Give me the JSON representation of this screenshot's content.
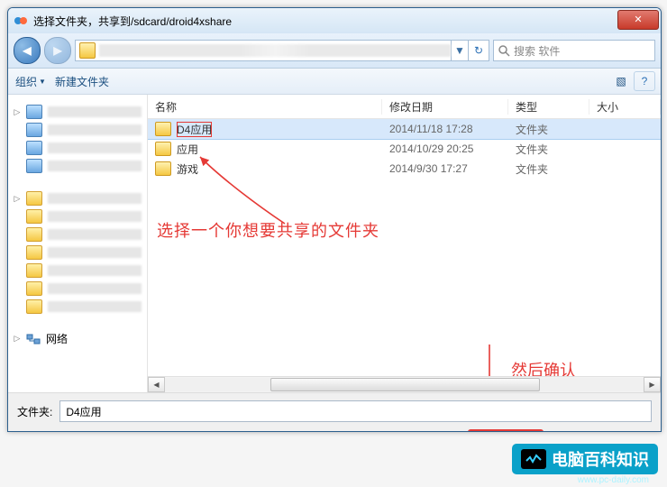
{
  "window": {
    "title": "选择文件夹，共享到/sdcard/droid4xshare",
    "close_x": "✕"
  },
  "nav": {
    "back_glyph": "◀",
    "fwd_glyph": "▶",
    "drop_glyph": "▼",
    "refresh_glyph": "↻"
  },
  "search": {
    "placeholder": "搜索 软件"
  },
  "toolbar": {
    "organize": "组织",
    "caret": "▼",
    "newfolder": "新建文件夹",
    "view_glyph": "▧",
    "help_glyph": "?"
  },
  "sidebar": {
    "network_label": "网络"
  },
  "columns": {
    "name": "名称",
    "date": "修改日期",
    "type": "类型",
    "size": "大小"
  },
  "rows": [
    {
      "name": "D4应用",
      "date": "2014/11/18 17:28",
      "type": "文件夹",
      "selected": true
    },
    {
      "name": "应用",
      "date": "2014/10/29 20:25",
      "type": "文件夹",
      "selected": false
    },
    {
      "name": "游戏",
      "date": "2014/9/30 17:27",
      "type": "文件夹",
      "selected": false
    }
  ],
  "annotations": {
    "pick_text": "选择一个你想要共享的文件夹",
    "confirm_text": "然后确认"
  },
  "footer": {
    "label": "文件夹:",
    "value": "D4应用"
  },
  "scrollbar": {
    "left_glyph": "◀",
    "right_glyph": "▶"
  },
  "watermark": {
    "text": "电脑百科知识",
    "url": "www.pc-daily.com"
  }
}
